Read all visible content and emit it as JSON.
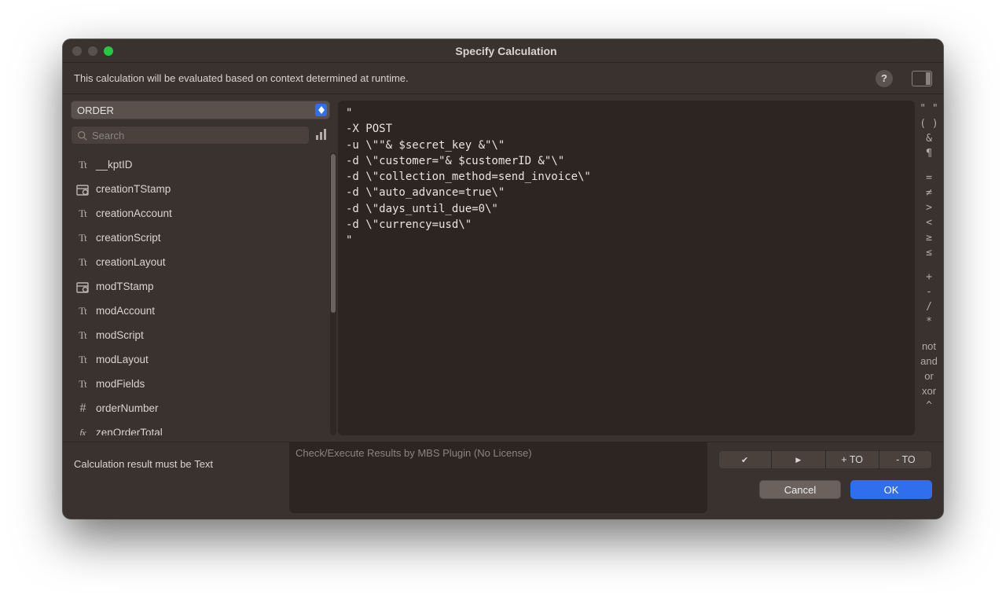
{
  "window": {
    "title": "Specify Calculation"
  },
  "info": {
    "text": "This calculation will be evaluated based on context determined at runtime."
  },
  "left": {
    "table_select": "ORDER",
    "search_placeholder": "Search",
    "fields": [
      {
        "icon": "text",
        "name": "__kptID"
      },
      {
        "icon": "tstamp",
        "name": "creationTStamp"
      },
      {
        "icon": "text",
        "name": "creationAccount"
      },
      {
        "icon": "text",
        "name": "creationScript"
      },
      {
        "icon": "text",
        "name": "creationLayout"
      },
      {
        "icon": "tstamp",
        "name": "modTStamp"
      },
      {
        "icon": "text",
        "name": "modAccount"
      },
      {
        "icon": "text",
        "name": "modScript"
      },
      {
        "icon": "text",
        "name": "modLayout"
      },
      {
        "icon": "text",
        "name": "modFields"
      },
      {
        "icon": "number",
        "name": "orderNumber"
      },
      {
        "icon": "fx",
        "name": "zenOrderTotal"
      }
    ]
  },
  "editor": {
    "lines": [
      "\"",
      "-X POST",
      "-u \\\"\"& $secret_key &\"\\\"",
      "-d \\\"customer=\"& $customerID &\"\\\"",
      "-d \\\"collection_method=send_invoice\\\"",
      "-d \\\"auto_advance=true\\\"",
      "-d \\\"days_until_due=0\\\"",
      "-d \\\"currency=usd\\\"",
      "\""
    ]
  },
  "ops": {
    "items": [
      "\" \"",
      "( )",
      "&",
      "¶",
      "",
      "=",
      "≠",
      ">",
      "<",
      "≥",
      "≤",
      "",
      "+",
      "-",
      "/",
      "*",
      "",
      "not",
      "and",
      "or",
      "xor",
      "^"
    ]
  },
  "footer": {
    "result_label": "Calculation result must be ",
    "result_type": "Text",
    "mbs_hint": "Check/Execute Results by MBS Plugin (No License)",
    "seg": {
      "plus_to": "+ TO",
      "minus_to": "- TO"
    },
    "cancel": "Cancel",
    "ok": "OK"
  }
}
